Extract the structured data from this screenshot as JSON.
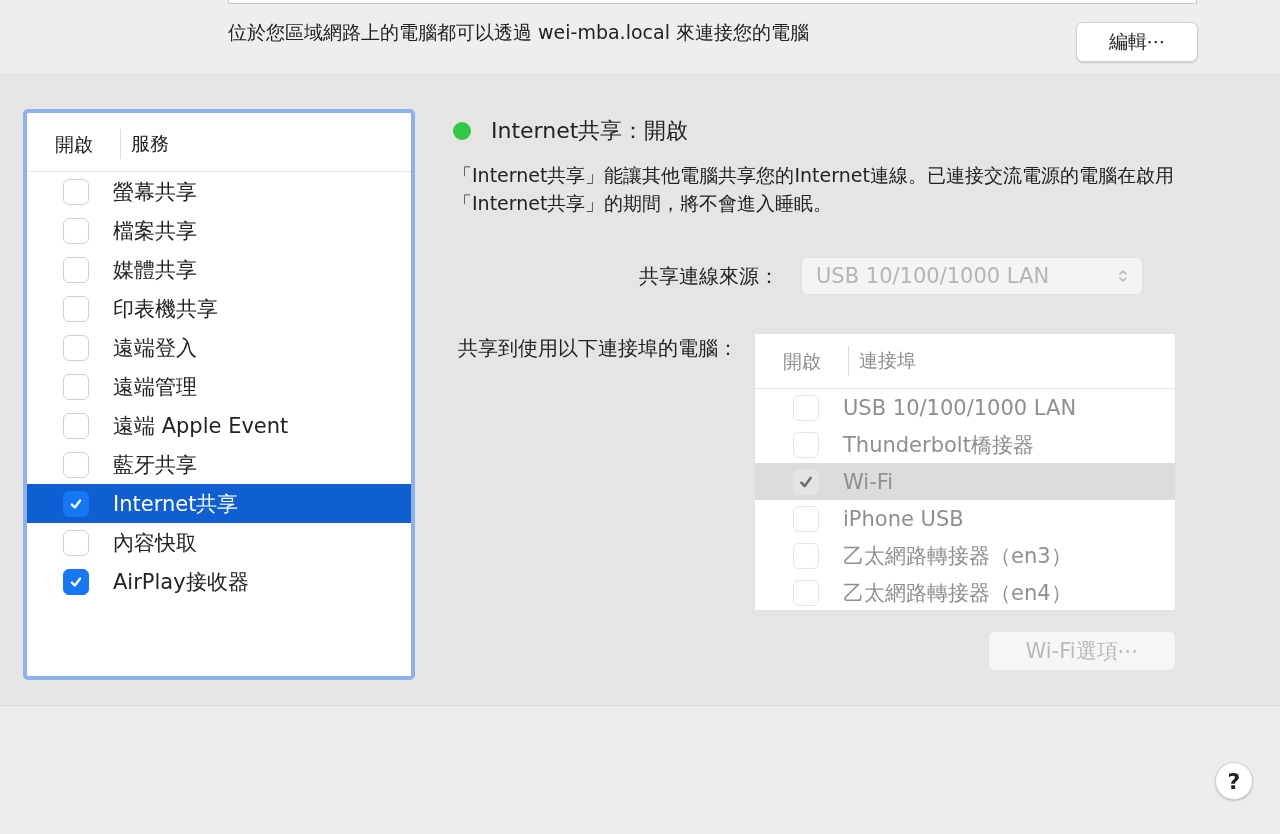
{
  "hostname_note": "位於您區域網路上的電腦都可以透過 wei-mba.local 來連接您的電腦",
  "edit_button": "編輯⋯",
  "services": {
    "columns": [
      "開啟",
      "服務"
    ],
    "items": [
      {
        "label": "螢幕共享",
        "checked": false,
        "selected": false
      },
      {
        "label": "檔案共享",
        "checked": false,
        "selected": false
      },
      {
        "label": "媒體共享",
        "checked": false,
        "selected": false
      },
      {
        "label": "印表機共享",
        "checked": false,
        "selected": false
      },
      {
        "label": "遠端登入",
        "checked": false,
        "selected": false
      },
      {
        "label": "遠端管理",
        "checked": false,
        "selected": false
      },
      {
        "label": "遠端 Apple Event",
        "checked": false,
        "selected": false
      },
      {
        "label": "藍牙共享",
        "checked": false,
        "selected": false
      },
      {
        "label": "Internet共享",
        "checked": true,
        "selected": true
      },
      {
        "label": "內容快取",
        "checked": false,
        "selected": false
      },
      {
        "label": "AirPlay接收器",
        "checked": true,
        "selected": false
      }
    ]
  },
  "status": {
    "text": "Internet共享：開啟",
    "color": "#2fc744"
  },
  "description": "「Internet共享」能讓其他電腦共享您的Internet連線。已連接交流電源的電腦在啟用「Internet共享」的期間，將不會進入睡眠。",
  "source": {
    "label": "共享連線來源：",
    "value": "USB 10/100/1000 LAN",
    "disabled": true
  },
  "ports": {
    "label": "共享到使用以下連接埠的電腦：",
    "disabled": true,
    "columns": [
      "開啟",
      "連接埠"
    ],
    "items": [
      {
        "label": "USB 10/100/1000 LAN",
        "checked": false,
        "selected": false
      },
      {
        "label": "Thunderbolt橋接器",
        "checked": false,
        "selected": false
      },
      {
        "label": "Wi-Fi",
        "checked": true,
        "selected": true
      },
      {
        "label": "iPhone USB",
        "checked": false,
        "selected": false
      },
      {
        "label": "乙太網路轉接器（en3）",
        "checked": false,
        "selected": false
      },
      {
        "label": "乙太網路轉接器（en4）",
        "checked": false,
        "selected": false
      }
    ]
  },
  "wifi_options": {
    "label": "Wi-Fi選項⋯",
    "disabled": true
  },
  "help_button": "?"
}
